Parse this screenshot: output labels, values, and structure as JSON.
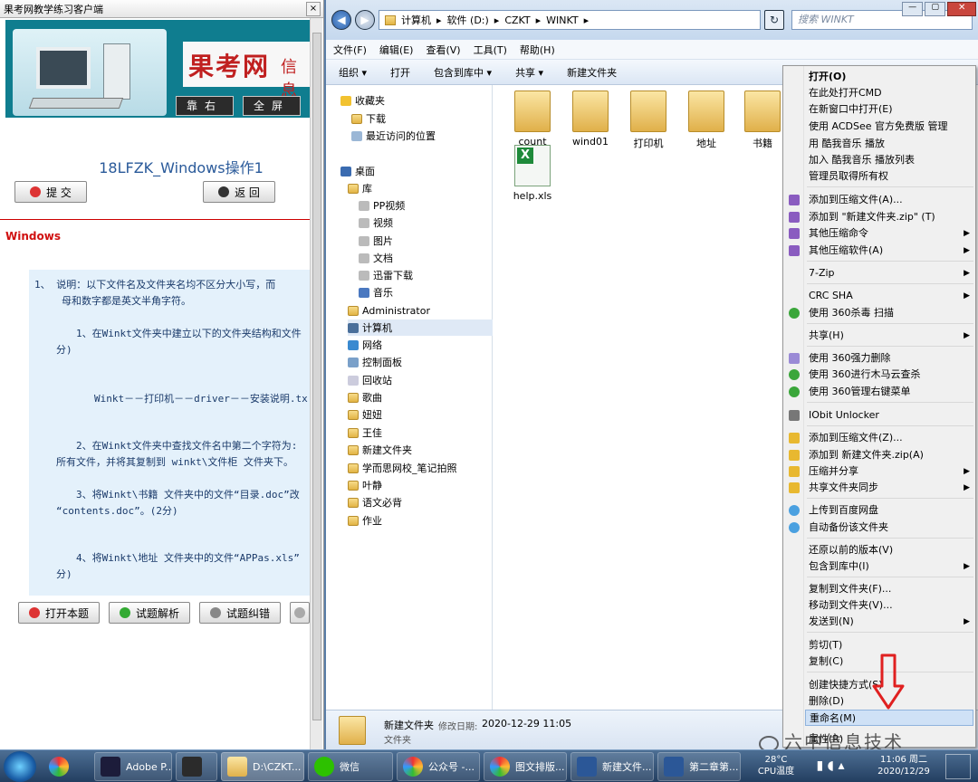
{
  "left": {
    "window_title": "果考网教学练习客户端",
    "close_glyph": "×",
    "brand": "果考网",
    "brand_tail": "信息",
    "btn_right": "靠右",
    "btn_full": "全屏",
    "question_title": "18LFZK_Windows操作1",
    "submit": "提 交",
    "back": "返 回",
    "section_label": "Windows",
    "lines": [
      "1、    说明：以下文件名及文件夹名均不区分大小写，而",
      "母和数字都是英文半角字符。",
      "1、在Winkt文件夹中建立以下的文件夹结构和文件",
      "分)",
      "Winkt－－打印机－－driver－－安装说明.tx",
      "2、在Winkt文件夹中查找文件名中第二个字符为:",
      "所有文件，并将其复制到 winkt\\文件柜 文件夹下。",
      "3、将Winkt\\书籍 文件夹中的文件“目录.doc”改",
      "“contents.doc”。(2分)",
      "4、将Winkt\\地址 文件夹中的文件“APPas.xls”",
      "分)"
    ],
    "btn_open": "打开本题",
    "btn_analysis": "试题解析",
    "btn_correct": "试题纠错"
  },
  "explorer": {
    "address": [
      "计算机",
      "软件 (D:)",
      "CZKT",
      "WINKT"
    ],
    "search_placeholder": "搜索 WINKT",
    "menu": [
      "文件(F)",
      "编辑(E)",
      "查看(V)",
      "工具(T)",
      "帮助(H)"
    ],
    "toolbar": [
      "组织 ▾",
      "打开",
      "包含到库中 ▾",
      "共享 ▾",
      "新建文件夹"
    ],
    "nav": [
      "收藏夹",
      "下载",
      "最近访问的位置",
      "桌面",
      "库",
      "PP视频",
      "视频",
      "图片",
      "文档",
      "迅雷下载",
      "音乐",
      "Administrator",
      "计算机",
      "网络",
      "控制面板",
      "回收站",
      "歌曲",
      "妞妞",
      "王佳",
      "新建文件夹",
      "学而思网校_笔记拍照",
      "叶静",
      "语文必背",
      "作业"
    ],
    "files": [
      "count",
      "wind01",
      "打印机",
      "地址",
      "书籍",
      "help.xls"
    ],
    "details_name": "新建文件夹",
    "details_date_label": "修改日期:",
    "details_date": "2020-12-29 11:05",
    "details_type": "文件夹"
  },
  "context_menu": [
    "打开(O)",
    "在此处打开CMD",
    "在新窗口中打开(E)",
    "使用 ACDSee 官方免费版 管理",
    "用 酷我音乐 播放",
    "加入 酷我音乐 播放列表",
    "管理员取得所有权",
    "添加到压缩文件(A)...",
    "添加到 \"新建文件夹.zip\" (T)",
    "其他压缩命令",
    "其他压缩软件(A)",
    "7-Zip",
    "CRC SHA",
    "使用 360杀毒 扫描",
    "共享(H)",
    "使用 360强力删除",
    "使用 360进行木马云查杀",
    "使用 360管理右键菜单",
    "IObit Unlocker",
    "添加到压缩文件(Z)...",
    "添加到 新建文件夹.zip(A)",
    "压缩并分享",
    "共享文件夹同步",
    "上传到百度网盘",
    "自动备份该文件夹",
    "还原以前的版本(V)",
    "包含到库中(I)",
    "复制到文件夹(F)...",
    "移动到文件夹(V)...",
    "发送到(N)",
    "剪切(T)",
    "复制(C)",
    "创建快捷方式(S)",
    "删除(D)",
    "重命名(M)",
    "属性(R)"
  ],
  "watermark": "六中信息技术",
  "taskbar": {
    "items": [
      "Adobe P...",
      "D:\\CZKT...",
      "微信",
      "公众号 -...",
      "图文排版...",
      "新建文件...",
      "第二章第..."
    ],
    "temp": "28°C",
    "temp_label": "CPU温度",
    "time": "11:06 周二",
    "date": "2020/12/29"
  },
  "colors": {
    "accent": "#2d5fa8",
    "question_text": "#1a3a6a",
    "red_label": "#d01010",
    "arrow": "#e02020"
  }
}
